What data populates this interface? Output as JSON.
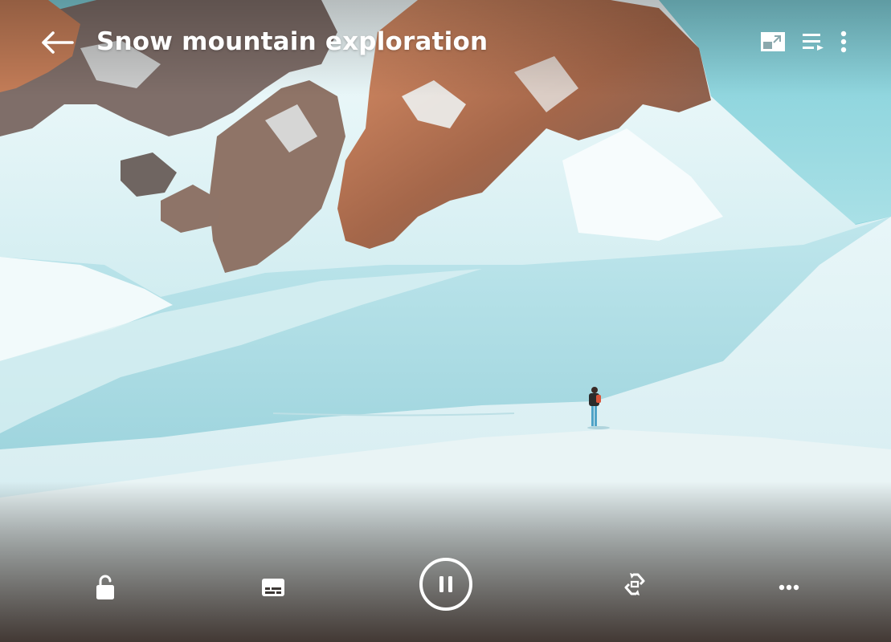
{
  "header": {
    "title": "Snow mountain exploration"
  },
  "icons": {
    "back": "arrow-left-icon",
    "pip": "picture-in-picture-icon",
    "playlist": "playlist-icon",
    "more": "more-vertical-icon",
    "lock": "unlock-icon",
    "subtitles": "subtitles-icon",
    "pause": "pause-icon",
    "rotate": "rotate-screen-icon",
    "more_horizontal": "more-horizontal-icon"
  },
  "colors": {
    "sky": "#8fd3de",
    "snow": "#e9f6f8",
    "rock": "#c77a4e",
    "overlay": "#2a2f33"
  }
}
